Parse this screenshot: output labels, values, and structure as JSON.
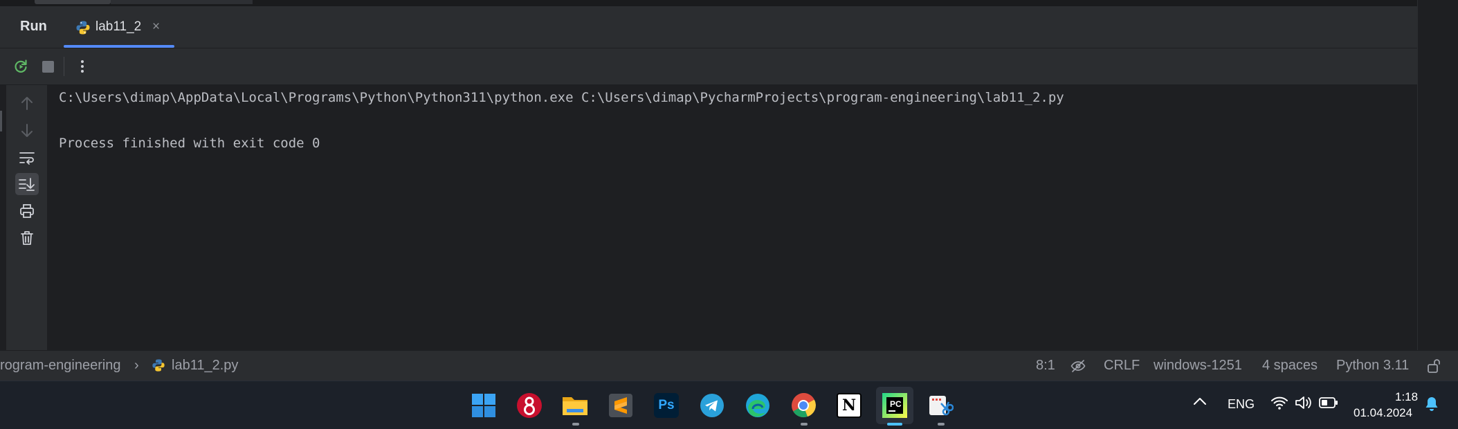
{
  "header": {
    "run_title": "Run",
    "tab_label": "lab11_2",
    "tab_close": "×"
  },
  "toolbar": {
    "rerun_icon": "rerun-icon",
    "stop_icon": "stop-icon",
    "more_icon": "more-vertical-icon"
  },
  "side_tools": [
    "arrow-up-icon",
    "arrow-down-icon",
    "soft-wrap-icon",
    "scroll-to-end-icon",
    "print-icon",
    "trash-icon"
  ],
  "console": {
    "command": "C:\\Users\\dimap\\AppData\\Local\\Programs\\Python\\Python311\\python.exe C:\\Users\\dimap\\PycharmProjects\\program-engineering\\lab11_2.py",
    "exit_message": "Process finished with exit code 0"
  },
  "status_bar": {
    "breadcrumb_project": "rogram-engineering",
    "breadcrumb_sep": "›",
    "breadcrumb_file": "lab11_2.py",
    "cursor_position": "8:1",
    "line_separator": "CRLF",
    "encoding": "windows-1251",
    "indent": "4 spaces",
    "interpreter": "Python 3.11"
  },
  "taskbar": {
    "apps": [
      {
        "name": "windows-start",
        "open": false
      },
      {
        "name": "app-8-red",
        "open": false
      },
      {
        "name": "file-explorer",
        "open": true
      },
      {
        "name": "sublime-text",
        "open": false
      },
      {
        "name": "photoshop",
        "open": false,
        "label": "Ps"
      },
      {
        "name": "telegram",
        "open": false
      },
      {
        "name": "edge",
        "open": false
      },
      {
        "name": "chrome",
        "open": true
      },
      {
        "name": "notion",
        "open": false,
        "label": "N"
      },
      {
        "name": "pycharm",
        "open": true,
        "active": true,
        "label": "PC"
      },
      {
        "name": "snipping-tool",
        "open": true
      }
    ],
    "tray": {
      "language": "ENG",
      "time": "1:18",
      "date": "01.04.2024"
    }
  },
  "colors": {
    "accent": "#548af7",
    "console_bg": "#1e1f22",
    "panel_bg": "#2b2d30",
    "taskbar_bg": "#1c2129",
    "active_indicator": "#4cc2ff"
  }
}
